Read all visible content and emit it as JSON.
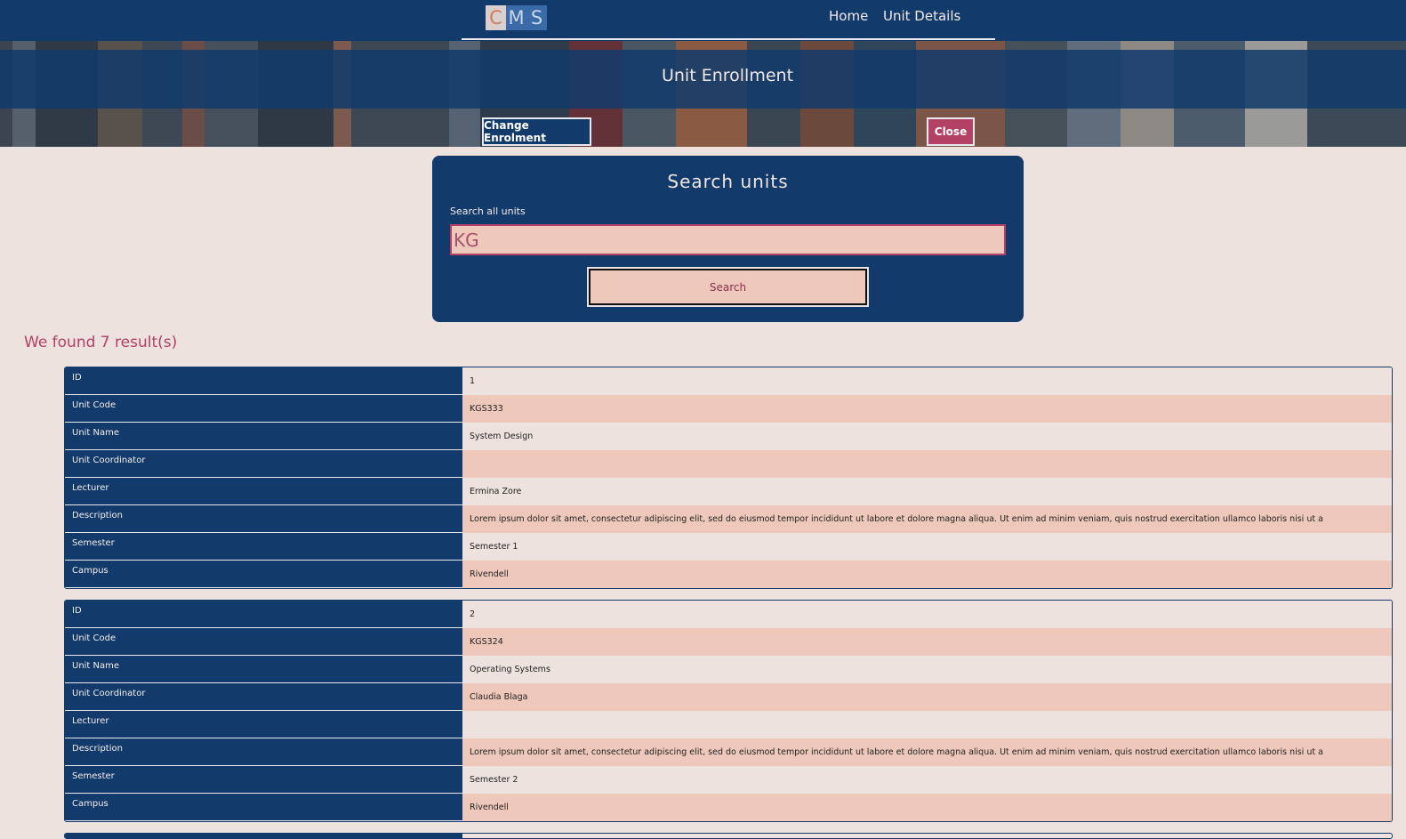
{
  "nav": {
    "logo": [
      "C",
      "M",
      "S"
    ],
    "links": [
      "Home",
      "Unit Details"
    ]
  },
  "banner": {
    "title": "Unit Enrollment",
    "change_button": "Change Enrolment",
    "close_button": "Close"
  },
  "search": {
    "title": "Search units",
    "label": "Search all units",
    "value": "KG",
    "button": "Search"
  },
  "results": {
    "summary": "We found 7 result(s)",
    "labels": [
      "ID",
      "Unit Code",
      "Unit Name",
      "Unit Coordinator",
      "Lecturer",
      "Description",
      "Semester",
      "Campus"
    ],
    "units": [
      {
        "id": "1",
        "unit_code": "KGS333",
        "unit_name": "System Design",
        "unit_coordinator": "",
        "lecturer": "Ermina Zore",
        "description": "Lorem ipsum dolor sit amet, consectetur adipiscing elit, sed do eiusmod tempor incididunt ut labore et dolore magna aliqua. Ut enim ad minim veniam, quis nostrud exercitation ullamco laboris nisi ut a",
        "semester": "Semester 1",
        "campus": "Rivendell"
      },
      {
        "id": "2",
        "unit_code": "KGS324",
        "unit_name": "Operating Systems",
        "unit_coordinator": "Claudia Blaga",
        "lecturer": "",
        "description": "Lorem ipsum dolor sit amet, consectetur adipiscing elit, sed do eiusmod tempor incididunt ut labore et dolore magna aliqua. Ut enim ad minim veniam, quis nostrud exercitation ullamco laboris nisi ut a",
        "semester": "Semester 2",
        "campus": "Rivendell"
      }
    ]
  },
  "colors": {
    "navy": "#123a6b",
    "accent": "#b34065",
    "peach": "#eec8bb",
    "background": "#ede2de"
  }
}
